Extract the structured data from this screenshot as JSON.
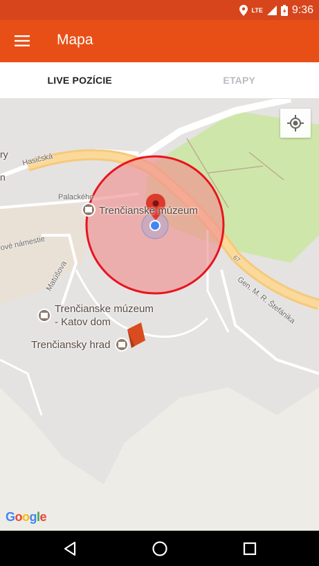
{
  "status_bar": {
    "time": "9:36",
    "network": "LTE"
  },
  "app_bar": {
    "title": "Mapa"
  },
  "tabs": [
    {
      "label": "LIVE POZÍCIE",
      "active": true
    },
    {
      "label": "ETAPY",
      "active": false
    }
  ],
  "map": {
    "places": {
      "museum": "Trenčianske múzeum",
      "museum_katov_line1": "Trenčianske múzeum",
      "museum_katov_line2": "- Katov dom",
      "castle": "Trenčiansky hrad",
      "partial_left_top": "ry",
      "partial_left_mid": "n"
    },
    "streets": {
      "hasicska": "Hasičská",
      "palackeho": "Palackého",
      "namestie": "ové námestie",
      "matusova": "Matúšova",
      "stefanika": "Gen. M. R. Štefánika",
      "short": "67"
    },
    "attribution": "Google",
    "colors": {
      "accent": "#e84f17",
      "geofence_fill": "#f0a0a0",
      "geofence_stroke": "#e8141e",
      "park": "#cfe6aa",
      "road_yellow": "#f6c97a"
    }
  }
}
